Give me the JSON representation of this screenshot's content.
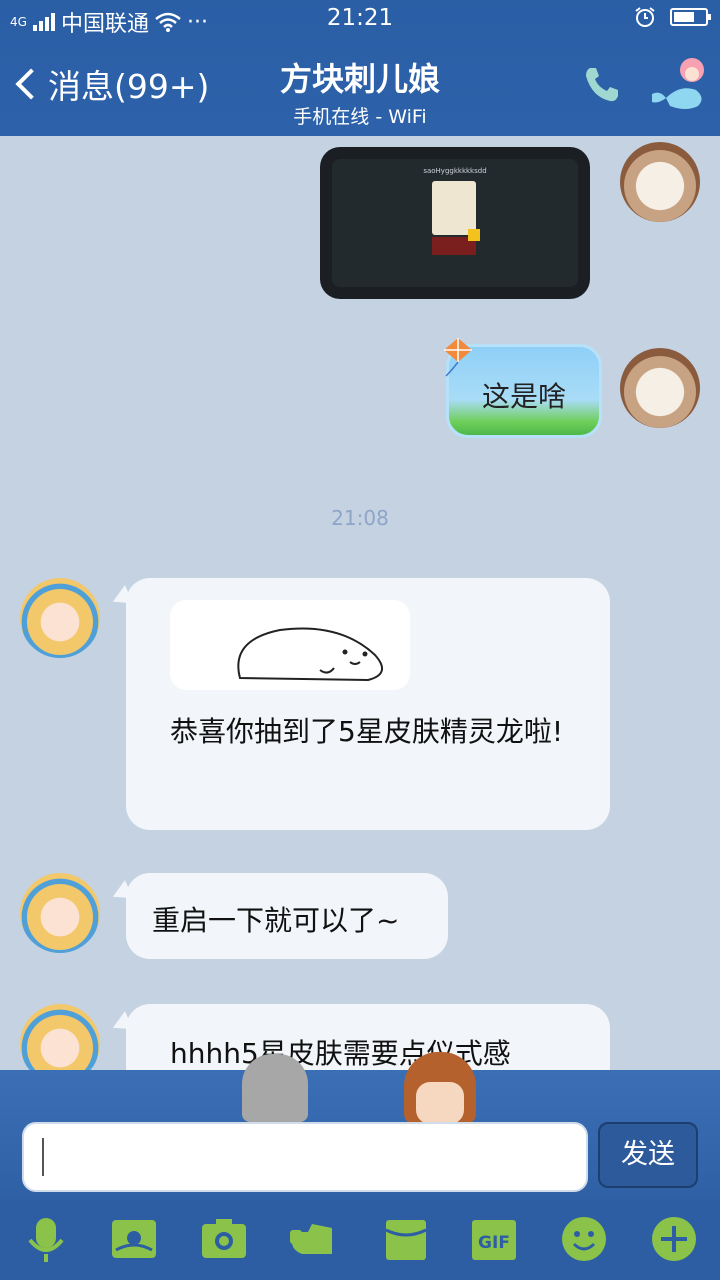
{
  "status_bar": {
    "network": "4G",
    "carrier": "中国联通",
    "more": "···",
    "time": "21:21"
  },
  "header": {
    "back_label": "消息(99+)",
    "title": "方块刺儿娘",
    "subtitle": "手机在线 - WiFi"
  },
  "messages": {
    "image_caption": "saoHyggkkkkksdd",
    "kite_text": "这是啥",
    "timestamp": "21:08",
    "m1_text": "恭喜你抽到了5星皮肤精灵龙啦!",
    "m2_text": "重启一下就可以了~",
    "m3_text": "hhhh5星皮肤需要点仪式感"
  },
  "input": {
    "value": "",
    "send_label": "发送"
  },
  "toolbar": {
    "gif_label": "GIF"
  },
  "colors": {
    "header_bg": "#2d62aa",
    "chat_bg": "#c4d2e2",
    "toolbar_icon": "#8bc34a"
  }
}
